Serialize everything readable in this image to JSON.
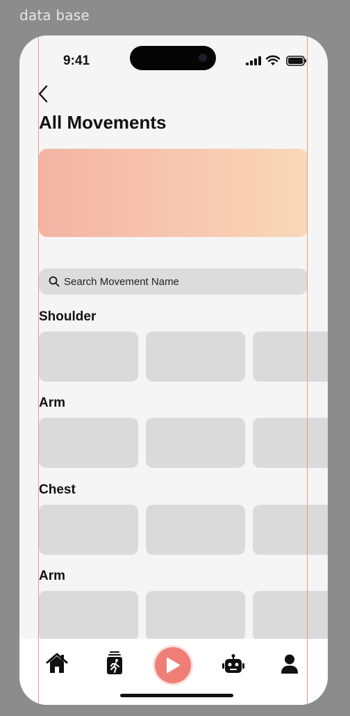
{
  "frame_label": "data base",
  "status_bar": {
    "time": "9:41"
  },
  "header": {
    "title": "All Movements"
  },
  "search": {
    "placeholder": "Search Movement Name"
  },
  "sections": [
    {
      "title": "Shoulder"
    },
    {
      "title": "Arm"
    },
    {
      "title": "Chest"
    },
    {
      "title": "Arm"
    }
  ],
  "tabbar": {
    "items": [
      "home-icon",
      "workout-log-icon",
      "play-icon",
      "robot-icon",
      "profile-icon"
    ]
  },
  "colors": {
    "accent": "#ef7f76",
    "banner_start": "#f4b4a4",
    "banner_end": "#f9d8b8",
    "card": "#dadada",
    "guide": "#e59a85"
  }
}
